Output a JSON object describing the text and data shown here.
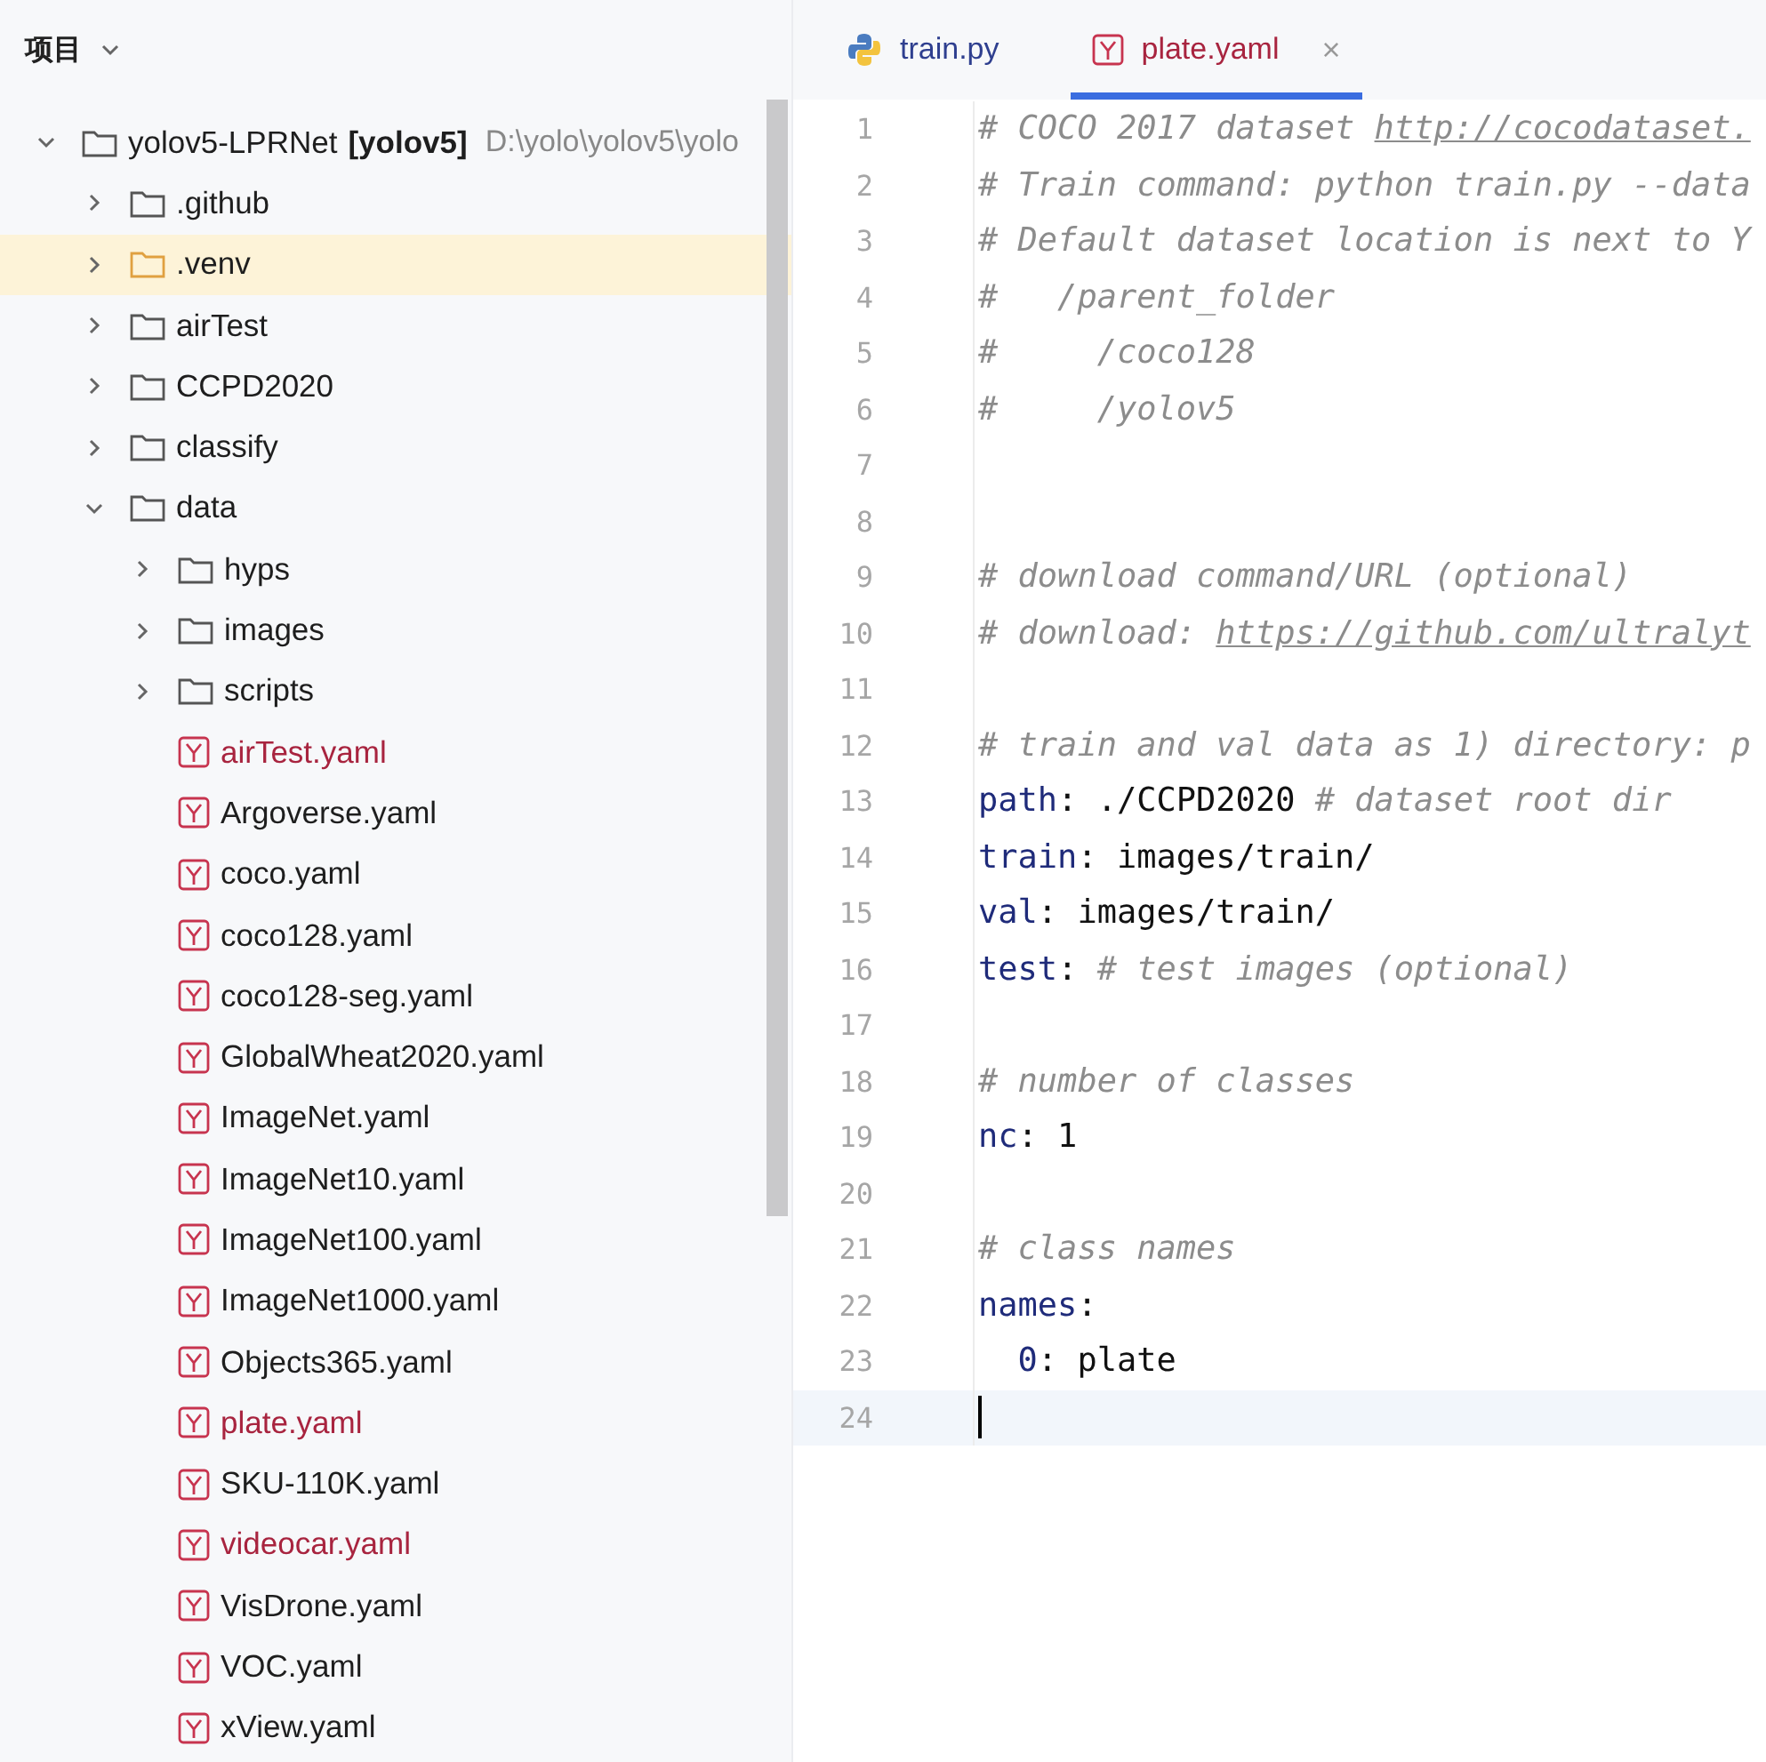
{
  "project_header": {
    "title": "项目"
  },
  "tree": [
    {
      "name": "yolov5-LPRNet",
      "module": "[yolov5]",
      "path": "D:\\yolo\\yolov5\\yolo",
      "kind": "folder",
      "expanded": true,
      "highlighted": false,
      "children": [
        {
          "name": ".github",
          "kind": "folder",
          "expanded": false,
          "highlighted": false
        },
        {
          "name": ".venv",
          "kind": "folder",
          "expanded": false,
          "highlighted": true
        },
        {
          "name": "airTest",
          "kind": "folder",
          "expanded": false,
          "highlighted": false
        },
        {
          "name": "CCPD2020",
          "kind": "folder",
          "expanded": false,
          "highlighted": false
        },
        {
          "name": "classify",
          "kind": "folder",
          "expanded": false,
          "highlighted": false
        },
        {
          "name": "data",
          "kind": "folder",
          "expanded": true,
          "highlighted": false,
          "children": [
            {
              "name": "hyps",
              "kind": "folder",
              "expanded": false,
              "highlighted": false
            },
            {
              "name": "images",
              "kind": "folder",
              "expanded": false,
              "highlighted": false
            },
            {
              "name": "scripts",
              "kind": "folder",
              "expanded": false,
              "highlighted": false
            },
            {
              "name": "airTest.yaml",
              "kind": "yaml",
              "modified": true
            },
            {
              "name": "Argoverse.yaml",
              "kind": "yaml",
              "modified": false
            },
            {
              "name": "coco.yaml",
              "kind": "yaml",
              "modified": false
            },
            {
              "name": "coco128.yaml",
              "kind": "yaml",
              "modified": false
            },
            {
              "name": "coco128-seg.yaml",
              "kind": "yaml",
              "modified": false
            },
            {
              "name": "GlobalWheat2020.yaml",
              "kind": "yaml",
              "modified": false
            },
            {
              "name": "ImageNet.yaml",
              "kind": "yaml",
              "modified": false
            },
            {
              "name": "ImageNet10.yaml",
              "kind": "yaml",
              "modified": false
            },
            {
              "name": "ImageNet100.yaml",
              "kind": "yaml",
              "modified": false
            },
            {
              "name": "ImageNet1000.yaml",
              "kind": "yaml",
              "modified": false
            },
            {
              "name": "Objects365.yaml",
              "kind": "yaml",
              "modified": false
            },
            {
              "name": "plate.yaml",
              "kind": "yaml",
              "modified": true
            },
            {
              "name": "SKU-110K.yaml",
              "kind": "yaml",
              "modified": false
            },
            {
              "name": "videocar.yaml",
              "kind": "yaml",
              "modified": true
            },
            {
              "name": "VisDrone.yaml",
              "kind": "yaml",
              "modified": false
            },
            {
              "name": "VOC.yaml",
              "kind": "yaml",
              "modified": false
            },
            {
              "name": "xView.yaml",
              "kind": "yaml",
              "modified": false
            }
          ]
        }
      ]
    }
  ],
  "tabs": [
    {
      "label": "train.py",
      "kind": "python",
      "selected": false
    },
    {
      "label": "plate.yaml",
      "kind": "yaml",
      "selected": true,
      "close": "×"
    }
  ],
  "editor": {
    "lines": [
      {
        "number": "1",
        "current": false,
        "segments": [
          {
            "kind": "comment",
            "text": "# COCO 2017 dataset "
          },
          {
            "kind": "link",
            "text": "http://cocodataset."
          }
        ]
      },
      {
        "number": "2",
        "current": false,
        "segments": [
          {
            "kind": "comment",
            "text": "# Train command: python train.py --data"
          }
        ]
      },
      {
        "number": "3",
        "current": false,
        "segments": [
          {
            "kind": "comment",
            "text": "# Default dataset location is next to Y"
          }
        ]
      },
      {
        "number": "4",
        "current": false,
        "segments": [
          {
            "kind": "comment",
            "text": "#   /parent_folder"
          }
        ]
      },
      {
        "number": "5",
        "current": false,
        "segments": [
          {
            "kind": "comment",
            "text": "#     /coco128"
          }
        ]
      },
      {
        "number": "6",
        "current": false,
        "segments": [
          {
            "kind": "comment",
            "text": "#     /yolov5"
          }
        ]
      },
      {
        "number": "7",
        "current": false
      },
      {
        "number": "8",
        "current": false
      },
      {
        "number": "9",
        "current": false,
        "segments": [
          {
            "kind": "comment",
            "text": "# download command/URL (optional)"
          }
        ]
      },
      {
        "number": "10",
        "current": false,
        "segments": [
          {
            "kind": "comment",
            "text": "# download: "
          },
          {
            "kind": "link",
            "text": "https://github.com/ultralyt"
          }
        ]
      },
      {
        "number": "11",
        "current": false
      },
      {
        "number": "12",
        "current": false,
        "segments": [
          {
            "kind": "comment",
            "text": "# train and val data as 1) directory: p"
          }
        ]
      },
      {
        "number": "13",
        "current": false,
        "segments": [
          {
            "kind": "key",
            "text": "path"
          },
          {
            "kind": "plain",
            "text": ": ./CCPD2020 "
          },
          {
            "kind": "comment",
            "text": "# dataset root dir"
          }
        ]
      },
      {
        "number": "14",
        "current": false,
        "segments": [
          {
            "kind": "key",
            "text": "train"
          },
          {
            "kind": "plain",
            "text": ": images/train/"
          }
        ]
      },
      {
        "number": "15",
        "current": false,
        "segments": [
          {
            "kind": "key",
            "text": "val"
          },
          {
            "kind": "plain",
            "text": ": images/train/"
          }
        ]
      },
      {
        "number": "16",
        "current": false,
        "segments": [
          {
            "kind": "key",
            "text": "test"
          },
          {
            "kind": "plain",
            "text": ": "
          },
          {
            "kind": "comment",
            "text": "# test images (optional)"
          }
        ]
      },
      {
        "number": "17",
        "current": false
      },
      {
        "number": "18",
        "current": false,
        "segments": [
          {
            "kind": "comment",
            "text": "# number of classes"
          }
        ]
      },
      {
        "number": "19",
        "current": false,
        "segments": [
          {
            "kind": "key",
            "text": "nc"
          },
          {
            "kind": "plain",
            "text": ": 1"
          }
        ]
      },
      {
        "number": "20",
        "current": false
      },
      {
        "number": "21",
        "current": false,
        "segments": [
          {
            "kind": "comment",
            "text": "# class names"
          }
        ]
      },
      {
        "number": "22",
        "current": false,
        "segments": [
          {
            "kind": "key",
            "text": "names"
          },
          {
            "kind": "plain",
            "text": ":"
          }
        ]
      },
      {
        "number": "23",
        "current": false,
        "segments": [
          {
            "kind": "key",
            "text": "  0"
          },
          {
            "kind": "plain",
            "text": ": plate"
          }
        ]
      },
      {
        "number": "24",
        "current": true
      }
    ]
  }
}
